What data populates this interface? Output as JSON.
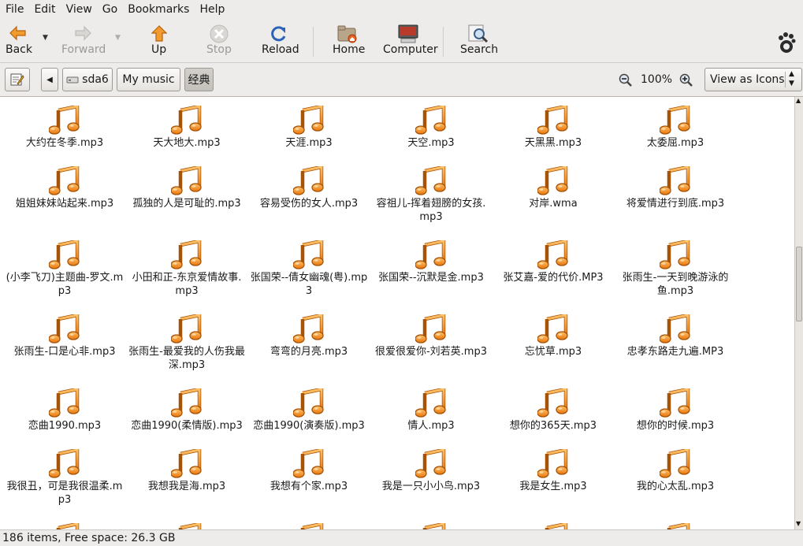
{
  "menu": [
    "File",
    "Edit",
    "View",
    "Go",
    "Bookmarks",
    "Help"
  ],
  "toolbar": {
    "back": "Back",
    "forward": "Forward",
    "up": "Up",
    "stop": "Stop",
    "reload": "Reload",
    "home": "Home",
    "computer": "Computer",
    "search": "Search"
  },
  "location": {
    "crumbs": [
      "sda6",
      "My music",
      "经典"
    ],
    "zoom": "100%",
    "view_mode": "View as Icons"
  },
  "files": [
    "大约在冬季.mp3",
    "天大地大.mp3",
    "天涯.mp3",
    "天空.mp3",
    "天黑黑.mp3",
    "太委屈.mp3",
    "姐姐妹妹站起来.mp3",
    "孤独的人是可耻的.mp3",
    "容易受伤的女人.mp3",
    "容祖儿-挥着翅膀的女孩.mp3",
    "对岸.wma",
    "将爱情进行到底.mp3",
    "(小李飞刀)主题曲-罗文.mp3",
    "小田和正-东京爱情故事.mp3",
    "张国荣--倩女幽魂(粤).mp3",
    "张国荣--沉默是金.mp3",
    "张艾嘉-爱的代价.MP3",
    "张雨生-一天到晚游泳的鱼.mp3",
    "张雨生-口是心非.mp3",
    "张雨生-最爱我的人伤我最深.mp3",
    "弯弯的月亮.mp3",
    "很爱很爱你-刘若英.mp3",
    "忘忧草.mp3",
    "忠孝东路走九遍.MP3",
    "恋曲1990.mp3",
    "恋曲1990(柔情版).mp3",
    "恋曲1990(演奏版).mp3",
    "情人.mp3",
    "想你的365天.mp3",
    "想你的时候.mp3",
    "我很丑，可是我很温柔.mp3",
    "我想我是海.mp3",
    "我想有个家.mp3",
    "我是一只小小鸟.mp3",
    "我是女生.mp3",
    "我的心太乱.mp3"
  ],
  "status": "186 items, Free space: 26.3 GB"
}
